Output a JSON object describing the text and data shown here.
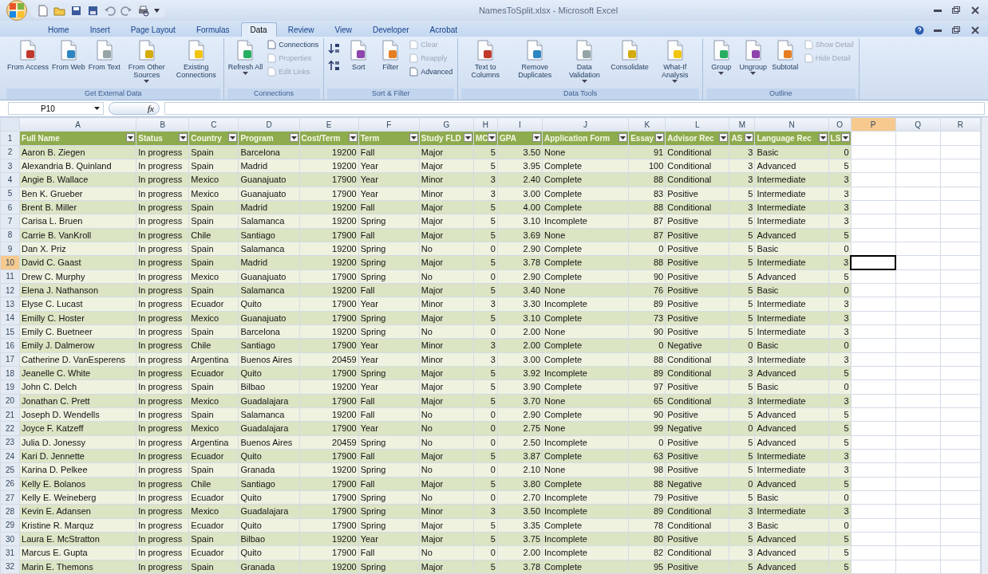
{
  "window": {
    "title": "NamesToSplit.xlsx - Microsoft Excel"
  },
  "tabs": [
    {
      "label": "Home",
      "selected": false
    },
    {
      "label": "Insert",
      "selected": false
    },
    {
      "label": "Page Layout",
      "selected": false
    },
    {
      "label": "Formulas",
      "selected": false
    },
    {
      "label": "Data",
      "selected": true
    },
    {
      "label": "Review",
      "selected": false
    },
    {
      "label": "View",
      "selected": false
    },
    {
      "label": "Developer",
      "selected": false
    },
    {
      "label": "Acrobat",
      "selected": false
    }
  ],
  "ribbon": {
    "groups": [
      {
        "label": "Get External Data",
        "items": [
          {
            "kind": "large",
            "label": "From Access",
            "menu": false
          },
          {
            "kind": "large",
            "label": "From Web",
            "menu": false
          },
          {
            "kind": "large",
            "label": "From Text",
            "menu": false
          },
          {
            "kind": "large",
            "label": "From Other Sources",
            "menu": true
          },
          {
            "kind": "large",
            "label": "Existing Connections",
            "menu": false
          }
        ]
      },
      {
        "label": "Connections",
        "items": [
          {
            "kind": "large",
            "label": "Refresh All",
            "menu": true
          },
          {
            "kind": "stack",
            "items": [
              {
                "label": "Connections",
                "disabled": false
              },
              {
                "label": "Properties",
                "disabled": true
              },
              {
                "label": "Edit Links",
                "disabled": true
              }
            ]
          }
        ]
      },
      {
        "label": "Sort & Filter",
        "items": [
          {
            "kind": "sort"
          },
          {
            "kind": "large",
            "label": "Sort",
            "menu": false
          },
          {
            "kind": "large",
            "label": "Filter",
            "menu": false
          },
          {
            "kind": "stack",
            "items": [
              {
                "label": "Clear",
                "disabled": true
              },
              {
                "label": "Reapply",
                "disabled": true
              },
              {
                "label": "Advanced",
                "disabled": false
              }
            ]
          }
        ]
      },
      {
        "label": "Data Tools",
        "items": [
          {
            "kind": "large",
            "label": "Text to Columns",
            "menu": false
          },
          {
            "kind": "large",
            "label": "Remove Duplicates",
            "menu": false
          },
          {
            "kind": "large",
            "label": "Data Validation",
            "menu": true
          },
          {
            "kind": "large",
            "label": "Consolidate",
            "menu": false
          },
          {
            "kind": "large",
            "label": "What-If Analysis",
            "menu": true
          }
        ]
      },
      {
        "label": "Outline",
        "items": [
          {
            "kind": "large",
            "label": "Group",
            "menu": true
          },
          {
            "kind": "large",
            "label": "Ungroup",
            "menu": true
          },
          {
            "kind": "large",
            "label": "Subtotal",
            "menu": false
          },
          {
            "kind": "stack",
            "items": [
              {
                "label": "Show Detail",
                "disabled": true
              },
              {
                "label": "Hide Detail",
                "disabled": true
              }
            ]
          }
        ]
      }
    ]
  },
  "formula_bar": {
    "name_box": "P10",
    "function_label": "fx"
  },
  "sheet": {
    "columns": [
      {
        "label": "A",
        "selected": false
      },
      {
        "label": "B",
        "selected": false
      },
      {
        "label": "C",
        "selected": false
      },
      {
        "label": "D",
        "selected": false
      },
      {
        "label": "E",
        "selected": false
      },
      {
        "label": "F",
        "selected": false
      },
      {
        "label": "G",
        "selected": false
      },
      {
        "label": "H",
        "selected": false
      },
      {
        "label": "I",
        "selected": false
      },
      {
        "label": "J",
        "selected": false
      },
      {
        "label": "K",
        "selected": false
      },
      {
        "label": "L",
        "selected": false
      },
      {
        "label": "M",
        "selected": false
      },
      {
        "label": "N",
        "selected": false
      },
      {
        "label": "O",
        "selected": false
      },
      {
        "label": "P",
        "selected": true
      },
      {
        "label": "Q",
        "selected": false
      },
      {
        "label": "R",
        "selected": false
      }
    ],
    "rows": [
      {
        "number": "1",
        "selected": false,
        "kind": "header",
        "cells": [
          "Full Name",
          "Status",
          "Country",
          "Program",
          "Cost/Term",
          "Term",
          "Study FLD",
          "MC",
          "GPA",
          "Application Form",
          "Essay",
          "Advisor Rec",
          "AS",
          "Language Rec",
          "LS"
        ]
      },
      {
        "number": "2",
        "selected": false,
        "kind": "data",
        "cells": [
          "Aaron B. Ziegen",
          "In progress",
          "Spain",
          "Barcelona",
          "19200",
          "Fall",
          "Major",
          "5",
          "3.50",
          "None",
          "91",
          "Conditional",
          "3",
          "Basic",
          "0"
        ]
      },
      {
        "number": "3",
        "selected": false,
        "kind": "data",
        "cells": [
          "Alexandria B. Quinland",
          "In progress",
          "Spain",
          "Madrid",
          "19200",
          "Year",
          "Major",
          "5",
          "3.95",
          "Complete",
          "100",
          "Conditional",
          "3",
          "Advanced",
          "5"
        ]
      },
      {
        "number": "4",
        "selected": false,
        "kind": "data",
        "cells": [
          "Angie B. Wallace",
          "In progress",
          "Mexico",
          "Guanajuato",
          "17900",
          "Year",
          "Minor",
          "3",
          "2.40",
          "Complete",
          "88",
          "Conditional",
          "3",
          "Intermediate",
          "3"
        ]
      },
      {
        "number": "5",
        "selected": false,
        "kind": "data",
        "cells": [
          "Ben K. Grueber",
          "In progress",
          "Mexico",
          "Guanajuato",
          "17900",
          "Year",
          "Minor",
          "3",
          "3.00",
          "Complete",
          "83",
          "Positive",
          "5",
          "Intermediate",
          "3"
        ]
      },
      {
        "number": "6",
        "selected": false,
        "kind": "data",
        "cells": [
          "Brent B. Miller",
          "In progress",
          "Spain",
          "Madrid",
          "19200",
          "Fall",
          "Major",
          "5",
          "4.00",
          "Complete",
          "88",
          "Conditional",
          "3",
          "Intermediate",
          "3"
        ]
      },
      {
        "number": "7",
        "selected": false,
        "kind": "data",
        "cells": [
          "Carisa L. Bruen",
          "In progress",
          "Spain",
          "Salamanca",
          "19200",
          "Spring",
          "Major",
          "5",
          "3.10",
          "Incomplete",
          "87",
          "Positive",
          "5",
          "Intermediate",
          "3"
        ]
      },
      {
        "number": "8",
        "selected": false,
        "kind": "data",
        "cells": [
          "Carrie B. VanKroll",
          "In progress",
          "Chile",
          "Santiago",
          "17900",
          "Fall",
          "Major",
          "5",
          "3.69",
          "None",
          "87",
          "Positive",
          "5",
          "Advanced",
          "5"
        ]
      },
      {
        "number": "9",
        "selected": false,
        "kind": "data",
        "cells": [
          "Dan X. Priz",
          "In progress",
          "Spain",
          "Salamanca",
          "19200",
          "Spring",
          "No",
          "0",
          "2.90",
          "Complete",
          "0",
          "Positive",
          "5",
          "Basic",
          "0"
        ]
      },
      {
        "number": "10",
        "selected": true,
        "kind": "data",
        "cells": [
          "David C. Gaast",
          "In progress",
          "Spain",
          "Madrid",
          "19200",
          "Spring",
          "Major",
          "5",
          "3.78",
          "Complete",
          "88",
          "Positive",
          "5",
          "Intermediate",
          "3"
        ]
      },
      {
        "number": "11",
        "selected": false,
        "kind": "data",
        "cells": [
          "Drew C. Murphy",
          "In progress",
          "Mexico",
          "Guanajuato",
          "17900",
          "Spring",
          "No",
          "0",
          "2.90",
          "Complete",
          "90",
          "Positive",
          "5",
          "Advanced",
          "5"
        ]
      },
      {
        "number": "12",
        "selected": false,
        "kind": "data",
        "cells": [
          "Elena J. Nathanson",
          "In progress",
          "Spain",
          "Salamanca",
          "19200",
          "Fall",
          "Major",
          "5",
          "3.40",
          "None",
          "76",
          "Positive",
          "5",
          "Basic",
          "0"
        ]
      },
      {
        "number": "13",
        "selected": false,
        "kind": "data",
        "cells": [
          "Elyse C. Lucast",
          "In progress",
          "Ecuador",
          "Quito",
          "17900",
          "Year",
          "Minor",
          "3",
          "3.30",
          "Incomplete",
          "89",
          "Positive",
          "5",
          "Intermediate",
          "3"
        ]
      },
      {
        "number": "14",
        "selected": false,
        "kind": "data",
        "cells": [
          "Emilly C. Hoster",
          "In progress",
          "Mexico",
          "Guanajuato",
          "17900",
          "Spring",
          "Major",
          "5",
          "3.10",
          "Complete",
          "73",
          "Positive",
          "5",
          "Intermediate",
          "3"
        ]
      },
      {
        "number": "15",
        "selected": false,
        "kind": "data",
        "cells": [
          "Emily C. Buetneer",
          "In progress",
          "Spain",
          "Barcelona",
          "19200",
          "Spring",
          "No",
          "0",
          "2.00",
          "None",
          "90",
          "Positive",
          "5",
          "Intermediate",
          "3"
        ]
      },
      {
        "number": "16",
        "selected": false,
        "kind": "data",
        "cells": [
          "Emily J. Dalmerow",
          "In progress",
          "Chile",
          "Santiago",
          "17900",
          "Year",
          "Minor",
          "3",
          "2.00",
          "Complete",
          "0",
          "Negative",
          "0",
          "Basic",
          "0"
        ]
      },
      {
        "number": "17",
        "selected": false,
        "kind": "data",
        "cells": [
          "Catherine D. VanEsperens",
          "In progress",
          "Argentina",
          "Buenos Aires",
          "20459",
          "Year",
          "Minor",
          "3",
          "3.00",
          "Complete",
          "88",
          "Conditional",
          "3",
          "Intermediate",
          "3"
        ]
      },
      {
        "number": "18",
        "selected": false,
        "kind": "data",
        "cells": [
          "Jeanelle C. White",
          "In progress",
          "Ecuador",
          "Quito",
          "17900",
          "Spring",
          "Major",
          "5",
          "3.92",
          "Incomplete",
          "89",
          "Conditional",
          "3",
          "Advanced",
          "5"
        ]
      },
      {
        "number": "19",
        "selected": false,
        "kind": "data",
        "cells": [
          "John C. Delch",
          "In progress",
          "Spain",
          "Bilbao",
          "19200",
          "Year",
          "Major",
          "5",
          "3.90",
          "Complete",
          "97",
          "Positive",
          "5",
          "Basic",
          "0"
        ]
      },
      {
        "number": "20",
        "selected": false,
        "kind": "data",
        "cells": [
          "Jonathan C. Prett",
          "In progress",
          "Mexico",
          "Guadalajara",
          "17900",
          "Fall",
          "Major",
          "5",
          "3.70",
          "None",
          "65",
          "Conditional",
          "3",
          "Intermediate",
          "3"
        ]
      },
      {
        "number": "21",
        "selected": false,
        "kind": "data",
        "cells": [
          "Joseph D. Wendells",
          "In progress",
          "Spain",
          "Salamanca",
          "19200",
          "Fall",
          "No",
          "0",
          "2.90",
          "Complete",
          "90",
          "Positive",
          "5",
          "Advanced",
          "5"
        ]
      },
      {
        "number": "22",
        "selected": false,
        "kind": "data",
        "cells": [
          "Joyce F. Katzeff",
          "In progress",
          "Mexico",
          "Guadalajara",
          "17900",
          "Year",
          "No",
          "0",
          "2.75",
          "None",
          "99",
          "Negative",
          "0",
          "Advanced",
          "5"
        ]
      },
      {
        "number": "23",
        "selected": false,
        "kind": "data",
        "cells": [
          "Julia D. Jonessy",
          "In progress",
          "Argentina",
          "Buenos Aires",
          "20459",
          "Spring",
          "No",
          "0",
          "2.50",
          "Incomplete",
          "0",
          "Positive",
          "5",
          "Advanced",
          "5"
        ]
      },
      {
        "number": "24",
        "selected": false,
        "kind": "data",
        "cells": [
          "Kari D. Jennette",
          "In progress",
          "Ecuador",
          "Quito",
          "17900",
          "Fall",
          "Major",
          "5",
          "3.87",
          "Complete",
          "63",
          "Positive",
          "5",
          "Intermediate",
          "3"
        ]
      },
      {
        "number": "25",
        "selected": false,
        "kind": "data",
        "cells": [
          "Karina D. Pelkee",
          "In progress",
          "Spain",
          "Granada",
          "19200",
          "Spring",
          "No",
          "0",
          "2.10",
          "None",
          "98",
          "Positive",
          "5",
          "Intermediate",
          "3"
        ]
      },
      {
        "number": "26",
        "selected": false,
        "kind": "data",
        "cells": [
          "Kelly E. Bolanos",
          "In progress",
          "Chile",
          "Santiago",
          "17900",
          "Fall",
          "Major",
          "5",
          "3.80",
          "Complete",
          "88",
          "Negative",
          "0",
          "Advanced",
          "5"
        ]
      },
      {
        "number": "27",
        "selected": false,
        "kind": "data",
        "cells": [
          "Kelly E. Weineberg",
          "In progress",
          "Ecuador",
          "Quito",
          "17900",
          "Spring",
          "No",
          "0",
          "2.70",
          "Incomplete",
          "79",
          "Positive",
          "5",
          "Basic",
          "0"
        ]
      },
      {
        "number": "28",
        "selected": false,
        "kind": "data",
        "cells": [
          "Kevin E. Adansen",
          "In progress",
          "Mexico",
          "Guadalajara",
          "17900",
          "Spring",
          "Minor",
          "3",
          "3.50",
          "Incomplete",
          "89",
          "Conditional",
          "3",
          "Intermediate",
          "3"
        ]
      },
      {
        "number": "29",
        "selected": false,
        "kind": "data",
        "cells": [
          "Kristine R. Marquz",
          "In progress",
          "Ecuador",
          "Quito",
          "17900",
          "Spring",
          "Major",
          "5",
          "3.35",
          "Complete",
          "78",
          "Conditional",
          "3",
          "Basic",
          "0"
        ]
      },
      {
        "number": "30",
        "selected": false,
        "kind": "data",
        "cells": [
          "Laura E. McStratton",
          "In progress",
          "Spain",
          "Bilbao",
          "19200",
          "Year",
          "Major",
          "5",
          "3.75",
          "Incomplete",
          "80",
          "Positive",
          "5",
          "Advanced",
          "5"
        ]
      },
      {
        "number": "31",
        "selected": false,
        "kind": "data",
        "cells": [
          "Marcus E. Gupta",
          "In progress",
          "Ecuador",
          "Quito",
          "17900",
          "Fall",
          "No",
          "0",
          "2.00",
          "Incomplete",
          "82",
          "Conditional",
          "3",
          "Advanced",
          "5"
        ]
      },
      {
        "number": "32",
        "selected": false,
        "kind": "data",
        "cells": [
          "Marin E. Themons",
          "In progress",
          "Spain",
          "Granada",
          "19200",
          "Spring",
          "Major",
          "5",
          "3.78",
          "Complete",
          "95",
          "Positive",
          "5",
          "Advanced",
          "5"
        ]
      }
    ]
  }
}
